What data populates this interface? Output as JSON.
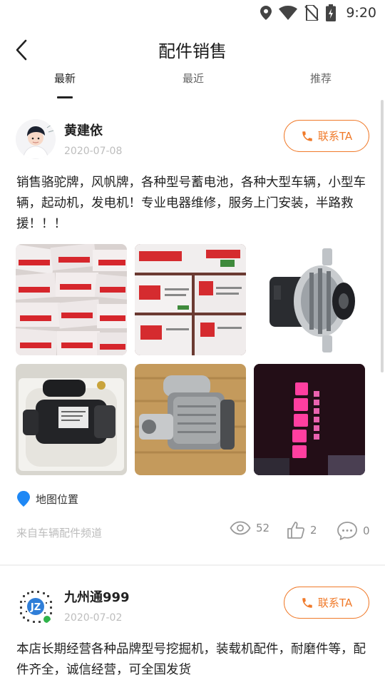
{
  "status_bar": {
    "time": "9:20",
    "icons": [
      "location-icon",
      "wifi-icon",
      "no-sim-icon",
      "battery-charging-icon"
    ]
  },
  "header": {
    "title": "配件销售",
    "back_icon": "chevron-left-icon"
  },
  "tabs": [
    {
      "label": "最新",
      "active": true
    },
    {
      "label": "最近",
      "active": false
    },
    {
      "label": "推荐",
      "active": false
    }
  ],
  "posts": [
    {
      "user": "黄建依",
      "date": "2020-07-08",
      "contact_label": "联系TA",
      "content": "销售骆驼牌，风帆牌，各种型号蓄电池，各种大型车辆，小型车辆，起动机，发电机！专业电器维修，服务上门安装，半路救援！！！",
      "image_icons": [
        "battery-boxes-image",
        "battery-boxes-image",
        "alternator-image",
        "starter-motor-image",
        "starter-motor-image",
        "neon-sign-image"
      ],
      "location_label": "地图位置",
      "source": "来自车辆配件频道",
      "views": "52",
      "likes": "2",
      "comments": "0"
    },
    {
      "user": "九州通999",
      "date": "2020-07-02",
      "contact_label": "联系TA",
      "content": "本店长期经营各种品牌型号挖掘机，装载机配件，耐磨件等，配件齐全，诚信经营，可全国发货"
    }
  ],
  "colors": {
    "accent": "#f07a2a",
    "location_pin": "#1e88f5",
    "muted": "#bdbdbd"
  }
}
